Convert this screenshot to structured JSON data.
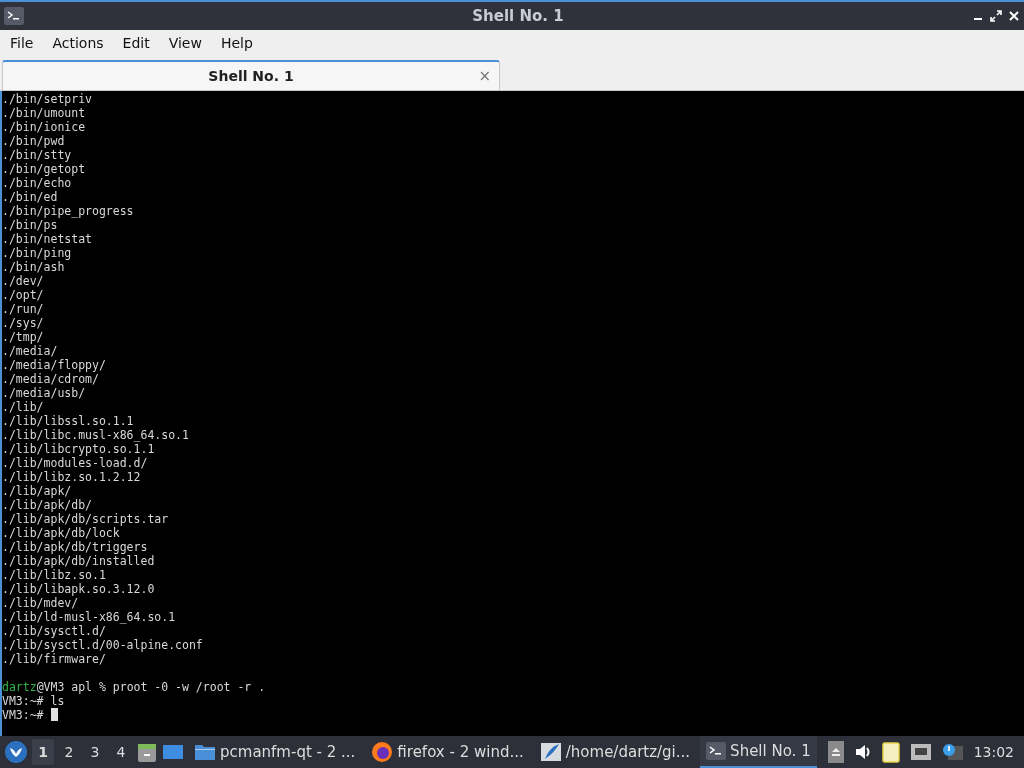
{
  "window": {
    "title": "Shell No. 1"
  },
  "menu": [
    "File",
    "Actions",
    "Edit",
    "View",
    "Help"
  ],
  "tabs": [
    {
      "label": "Shell No. 1",
      "selected": true,
      "close": "×"
    }
  ],
  "terminal": {
    "lines": [
      {
        "text": "./bin/setpriv"
      },
      {
        "text": "./bin/umount"
      },
      {
        "text": "./bin/ionice"
      },
      {
        "text": "./bin/pwd"
      },
      {
        "text": "./bin/stty"
      },
      {
        "text": "./bin/getopt"
      },
      {
        "text": "./bin/echo"
      },
      {
        "text": "./bin/ed"
      },
      {
        "text": "./bin/pipe_progress"
      },
      {
        "text": "./bin/ps"
      },
      {
        "text": "./bin/netstat"
      },
      {
        "text": "./bin/ping"
      },
      {
        "text": "./bin/ash"
      },
      {
        "text": "./dev/"
      },
      {
        "text": "./opt/"
      },
      {
        "text": "./run/"
      },
      {
        "text": "./sys/"
      },
      {
        "text": "./tmp/"
      },
      {
        "text": "./media/"
      },
      {
        "text": "./media/floppy/"
      },
      {
        "text": "./media/cdrom/"
      },
      {
        "text": "./media/usb/"
      },
      {
        "text": "./lib/"
      },
      {
        "text": "./lib/libssl.so.1.1"
      },
      {
        "text": "./lib/libc.musl-x86_64.so.1"
      },
      {
        "text": "./lib/libcrypto.so.1.1"
      },
      {
        "text": "./lib/modules-load.d/"
      },
      {
        "text": "./lib/libz.so.1.2.12"
      },
      {
        "text": "./lib/apk/"
      },
      {
        "text": "./lib/apk/db/"
      },
      {
        "text": "./lib/apk/db/scripts.tar"
      },
      {
        "text": "./lib/apk/db/lock"
      },
      {
        "text": "./lib/apk/db/triggers"
      },
      {
        "text": "./lib/apk/db/installed"
      },
      {
        "text": "./lib/libz.so.1"
      },
      {
        "text": "./lib/libapk.so.3.12.0"
      },
      {
        "text": "./lib/mdev/"
      },
      {
        "text": "./lib/ld-musl-x86_64.so.1"
      },
      {
        "text": "./lib/sysctl.d/"
      },
      {
        "text": "./lib/sysctl.d/00-alpine.conf"
      },
      {
        "text": "./lib/firmware/"
      },
      {
        "user": "dartz",
        "text": "@VM3 apl % proot -0 -w /root -r ."
      },
      {
        "text": "VM3:~# ls"
      },
      {
        "text": "VM3:~#",
        "cursor": true
      }
    ]
  },
  "taskbar": {
    "desktops": [
      {
        "label": "1",
        "selected": true
      },
      {
        "label": "2",
        "selected": false
      },
      {
        "label": "3",
        "selected": false
      },
      {
        "label": "4",
        "selected": false
      }
    ],
    "tasks": [
      {
        "kind": "folder",
        "label": "pcmanfm-qt - 2 ...",
        "selected": false
      },
      {
        "kind": "browser",
        "label": "firefox - 2 wind...",
        "selected": false
      },
      {
        "kind": "editor",
        "label": "/home/dartz/gi...",
        "selected": false
      },
      {
        "kind": "terminal",
        "label": "Shell No. 1",
        "selected": true
      }
    ],
    "clock": "13:02"
  }
}
